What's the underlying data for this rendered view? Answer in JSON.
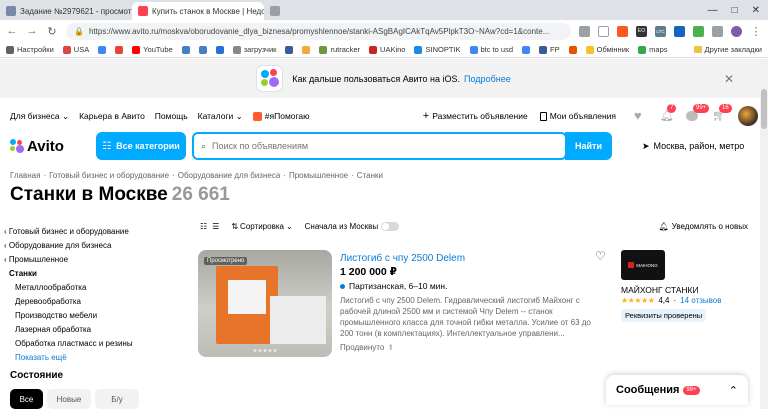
{
  "browser": {
    "tabs": [
      {
        "title": "Задание №2979621 - просмотр з",
        "color": "#7a88a8",
        "active": false
      },
      {
        "title": "Купить станок в Москве | Недор",
        "color": "#ff4053",
        "active": true
      },
      {
        "title": "",
        "color": "#9aa0a6",
        "active": false
      }
    ],
    "window_controls": [
      "—",
      "□",
      "✕"
    ],
    "url": "https://www.avito.ru/moskva/oborudovanie_dlya_biznesa/promyshlennoe/stanki-ASgBAgICAkTqAv5PlpkT3O~NAw?cd=1&conte...",
    "extension_labels": [
      "ЕО",
      "LTC",
      "0.3"
    ]
  },
  "bookmarks": {
    "items": [
      {
        "label": "Настройки",
        "color": "#5f6368"
      },
      {
        "label": "USA",
        "color": "#d44"
      },
      {
        "label": "",
        "color": "#4285f4"
      },
      {
        "label": "",
        "color": "#ea4335"
      },
      {
        "label": "YouTube",
        "color": "#ff0000"
      },
      {
        "label": "",
        "color": "#4680c2"
      },
      {
        "label": "",
        "color": "#4680c2"
      },
      {
        "label": "",
        "color": "#2a6fd6"
      },
      {
        "label": "загрузчик",
        "color": "#888"
      },
      {
        "label": "",
        "color": "#3b5998"
      },
      {
        "label": "",
        "color": "#f2a93b"
      },
      {
        "label": "rutracker",
        "color": "#6a9a3a"
      },
      {
        "label": "UAKino",
        "color": "#c22"
      },
      {
        "label": "SINOPTIK",
        "color": "#1e88e5"
      },
      {
        "label": "btc to usd",
        "color": "#4285f4"
      },
      {
        "label": "",
        "color": "#4285f4"
      },
      {
        "label": "FP",
        "color": "#3b5998"
      },
      {
        "label": "",
        "color": "#e65100"
      },
      {
        "label": "Обмінник",
        "color": "#fbc02d"
      },
      {
        "label": "maps",
        "color": "#34a853"
      }
    ],
    "other": "Другие закладки"
  },
  "banner": {
    "text": "Как дальше пользоваться Авито на iOS.",
    "link": "Подробнее"
  },
  "topnav": {
    "left": [
      "Для бизнеса",
      "Карьера в Авито",
      "Помощь",
      "Каталоги",
      "#яПомогаю"
    ],
    "post_ad": "Разместить объявление",
    "my_ads": "Мои объявления",
    "badges": {
      "notifications": "7",
      "messages": "99+",
      "cart": "16"
    }
  },
  "search": {
    "logo": "Avito",
    "categories_button": "Все категории",
    "placeholder": "Поиск по объявлениям",
    "find_button": "Найти",
    "location": "Москва, район, метро"
  },
  "breadcrumb": [
    "Главная",
    "Готовый бизнес и оборудование",
    "Оборудование для бизнеса",
    "Промышленное",
    "Станки"
  ],
  "page": {
    "title": "Станки в Москве",
    "count": "26 661"
  },
  "sortbar": {
    "sort": "Сортировка",
    "moscow_first": "Сначала из Москвы",
    "notify": "Уведомлять о новых"
  },
  "sidebar": {
    "items": [
      {
        "label": "Готовый бизнес и оборудование",
        "kind": "back"
      },
      {
        "label": "Оборудование для бизнеса",
        "kind": "back"
      },
      {
        "label": "Промышленное",
        "kind": "back"
      },
      {
        "label": "Станки",
        "kind": "cur"
      },
      {
        "label": "Металлообработка",
        "kind": "sub"
      },
      {
        "label": "Деревообработка",
        "kind": "sub"
      },
      {
        "label": "Производство мебели",
        "kind": "sub"
      },
      {
        "label": "Лазерная обработка",
        "kind": "sub"
      },
      {
        "label": "Обработка пластмасс и резины",
        "kind": "sub"
      },
      {
        "label": "Показать ещё",
        "kind": "link"
      }
    ],
    "condition_heading": "Состояние",
    "condition_tabs": [
      "Все",
      "Новые",
      "Б/у"
    ]
  },
  "listing": {
    "photo_tag": "Просмотрено",
    "title": "Листогиб с чпу 2500 Delem",
    "price": "1 200 000 ₽",
    "metro": "Партизанская, 6–10 мин.",
    "description": "Листогиб с чпу 2500 Delem. Гидравлический листогиб Майхонг с рабочей длиной 2500 мм и системой Чпу Delem -- станок промышленного класса для точной гибки металла. Усилие от 63 до 200 тонн (в комплектациях). Интеллектуальное управлени...",
    "promote": "Продвинуто"
  },
  "seller": {
    "logo_text": "MAIHONG",
    "name": "МАЙХОНГ СТАНКИ",
    "stars": "★★★★★",
    "rating": "4,4",
    "reviews": "14 отзывов",
    "badge": "Реквизиты проверены"
  },
  "messages": {
    "label": "Сообщения",
    "count": "99+"
  }
}
